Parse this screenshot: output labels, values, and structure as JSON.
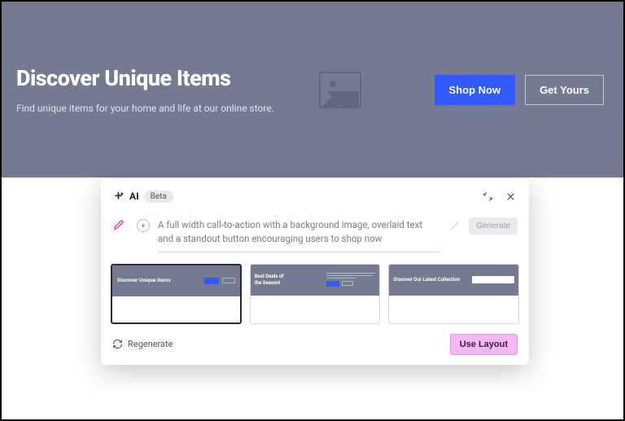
{
  "hero": {
    "title": "Discover Unique Items",
    "subtitle": "Find unique items for your home and life at our online store.",
    "primary_cta": "Shop Now",
    "secondary_cta": "Get Yours"
  },
  "panel": {
    "ai_label": "AI",
    "beta_label": "Beta",
    "prompt": "A full width call-to-action with a background image, overlaid text and a standout button encouraging users to shop now",
    "generate_label": "Generate",
    "regenerate_label": "Regenerate",
    "use_layout_label": "Use Layout",
    "thumbs": [
      {
        "title": "Discover Unique Items",
        "selected": true
      },
      {
        "title": "Best Deals of the Season!",
        "selected": false
      },
      {
        "title": "Discover Our Latest Collection",
        "selected": false
      }
    ]
  },
  "colors": {
    "hero_bg": "#757a91",
    "primary": "#2f5bff",
    "accent_pink": "#e838cc",
    "use_layout_bg": "#f3b7f4"
  }
}
